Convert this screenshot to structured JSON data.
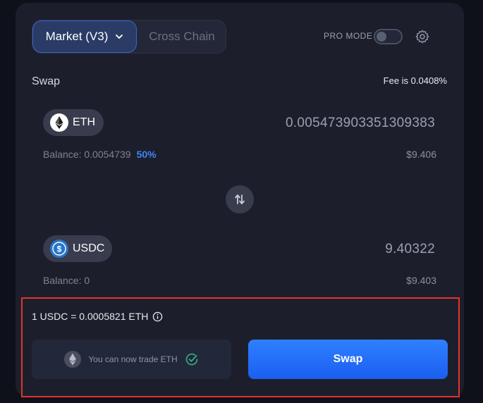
{
  "header": {
    "tabs": [
      {
        "label": "Market (V3)",
        "active": true
      },
      {
        "label": "Cross Chain",
        "active": false
      }
    ],
    "pro_mode_label": "PRO MODE",
    "pro_mode_enabled": false
  },
  "swap": {
    "title": "Swap",
    "fee": "Fee is 0.0408%"
  },
  "from_token": {
    "symbol": "ETH",
    "icon": "ethereum-icon",
    "amount": "0.005473903351309383",
    "balance": "Balance: 0.0054739",
    "percent_link": "50%",
    "usd_value": "$9.406"
  },
  "to_token": {
    "symbol": "USDC",
    "icon": "usdc-icon",
    "amount": "9.40322",
    "balance": "Balance: 0",
    "usd_value": "$9.403"
  },
  "footer": {
    "rate": "1 USDC = 0.0005821 ETH",
    "trade_notice": "You can now trade ETH",
    "swap_button": "Swap"
  },
  "colors": {
    "accent": "#2f80ff",
    "highlight_border": "#e5322a",
    "check": "#2fb380"
  }
}
